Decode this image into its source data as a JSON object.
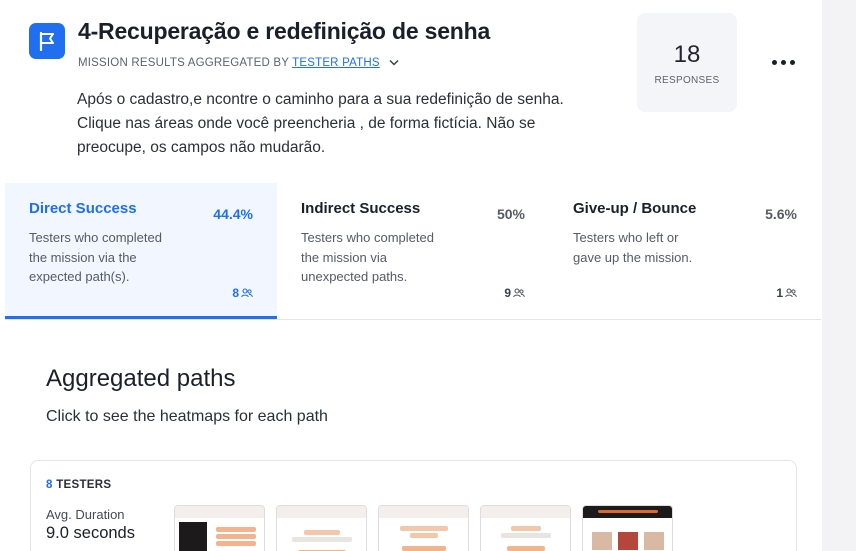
{
  "header": {
    "title": "4-Recuperação e redefinição de senha",
    "subtitle_prefix": "MISSION RESULTS AGGREGATED BY",
    "subtitle_link": "TESTER PATHS",
    "description": "Após o cadastro,e ncontre o caminho para a sua redefinição de senha. Clique nas áreas onde você preencheria , de forma fictícia. Não se preocupe, os campos não mudarão."
  },
  "responses": {
    "count": "18",
    "label": "RESPONSES"
  },
  "stats": [
    {
      "name": "Direct Success",
      "pct": "44.4%",
      "desc": "Testers who completed the mission via the expected path(s).",
      "count": "8"
    },
    {
      "name": "Indirect Success",
      "pct": "50%",
      "desc": "Testers who completed the mission via unexpected paths.",
      "count": "9"
    },
    {
      "name": "Give-up / Bounce",
      "pct": "5.6%",
      "desc": "Testers who left or gave up the mission.",
      "count": "1"
    }
  ],
  "aggregated": {
    "title": "Aggregated paths",
    "subtitle": "Click to see the heatmaps for each path"
  },
  "path": {
    "testers_count": "8",
    "testers_label": "TESTERS",
    "duration_label": "Avg. Duration",
    "duration_value": "9.0 seconds"
  },
  "colors": {
    "accent": "#1f6ff0",
    "active_bg": "#f1f6ff",
    "thumb_orange": "#e0662a"
  },
  "icons": {
    "badge": "flag-icon",
    "more": "more-horizontal-icon",
    "count": "users-icon",
    "subtitle": "chevron-down-icon"
  }
}
